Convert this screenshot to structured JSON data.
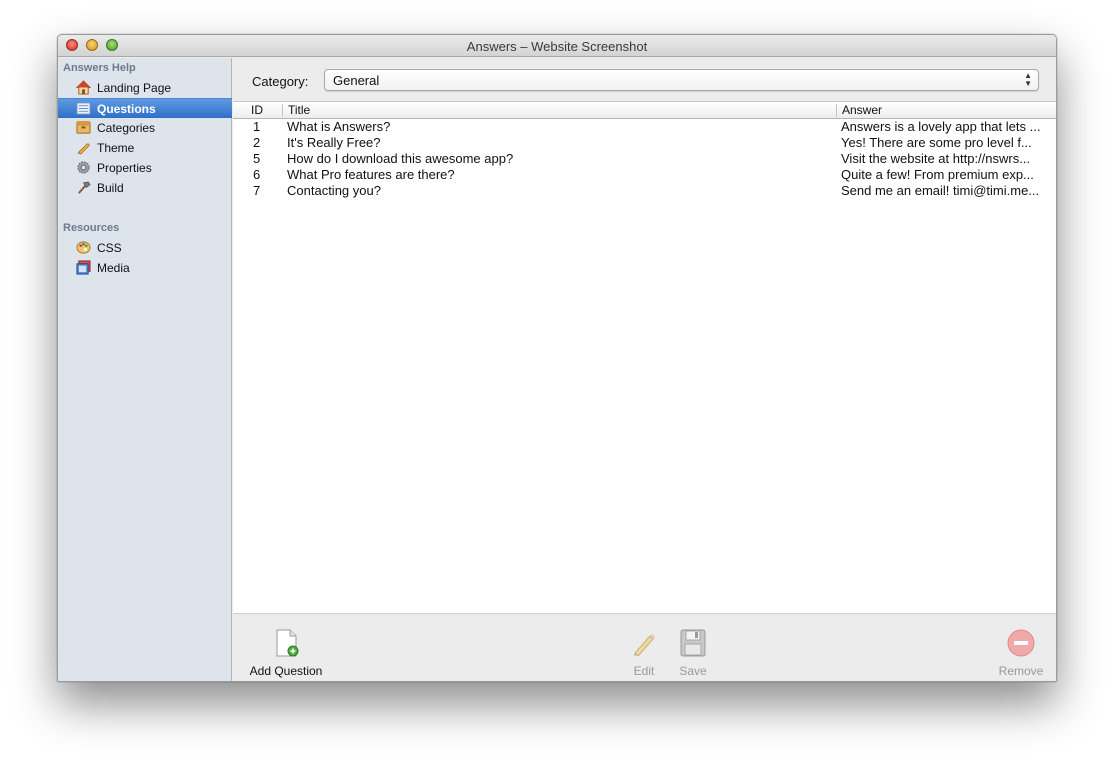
{
  "window": {
    "title": "Answers – Website Screenshot"
  },
  "sidebar": {
    "groups": [
      {
        "heading": "Answers Help",
        "items": [
          {
            "label": "Landing Page",
            "icon": "house-icon"
          },
          {
            "label": "Questions",
            "icon": "list-icon",
            "selected": true
          },
          {
            "label": "Categories",
            "icon": "box-icon"
          },
          {
            "label": "Theme",
            "icon": "pencil-icon"
          },
          {
            "label": "Properties",
            "icon": "gear-icon"
          },
          {
            "label": "Build",
            "icon": "hammer-icon"
          }
        ]
      },
      {
        "heading": "Resources",
        "items": [
          {
            "label": "CSS",
            "icon": "palette-icon"
          },
          {
            "label": "Media",
            "icon": "picture-icon"
          }
        ]
      }
    ]
  },
  "category": {
    "label": "Category:",
    "selected": "General"
  },
  "table": {
    "columns": {
      "id": "ID",
      "title": "Title",
      "answer": "Answer"
    },
    "rows": [
      {
        "id": "1",
        "title": "What is Answers?",
        "answer": "Answers is a lovely app that lets ..."
      },
      {
        "id": "2",
        "title": "It's Really Free?",
        "answer": "Yes!  There are some pro level f..."
      },
      {
        "id": "5",
        "title": "How do I download this awesome app?",
        "answer": "Visit the website at http://nswrs..."
      },
      {
        "id": "6",
        "title": "What Pro features are there?",
        "answer": "Quite a few!  From premium exp..."
      },
      {
        "id": "7",
        "title": "Contacting you?",
        "answer": "Send me an email! timi@timi.me..."
      }
    ]
  },
  "bottom_toolbar": {
    "add_label": "Add Question",
    "edit_label": "Edit",
    "save_label": "Save",
    "remove_label": "Remove"
  },
  "colors": {
    "selection": "#3a7bd5",
    "sidebar_bg": "#dde4ec"
  }
}
